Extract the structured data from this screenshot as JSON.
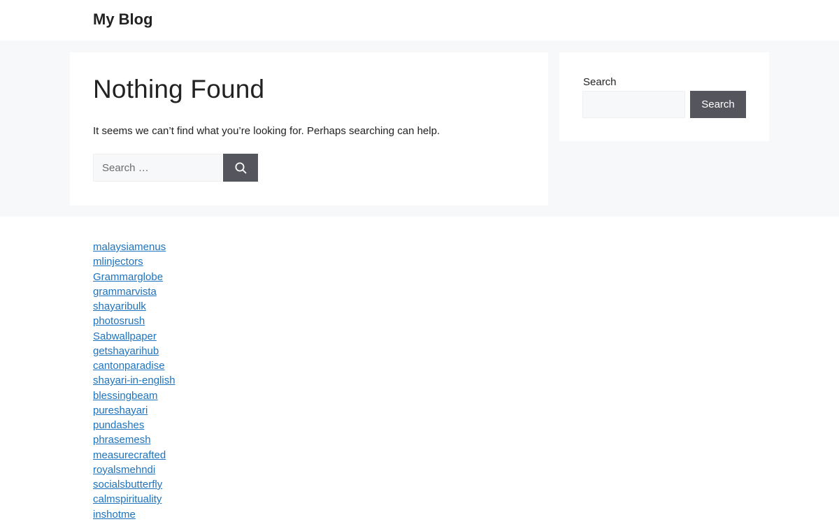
{
  "site": {
    "title": "My Blog"
  },
  "main": {
    "heading": "Nothing Found",
    "message": "It seems we can’t find what you’re looking for. Perhaps searching can help.",
    "search": {
      "placeholder": "Search …",
      "value": "",
      "submit_icon": "search-icon"
    }
  },
  "sidebar": {
    "widget_label": "Search",
    "input_value": "",
    "button_label": "Search"
  },
  "colors": {
    "background_band": "#f7f8f9",
    "button": "#55555e",
    "link": "#1e73be"
  },
  "links": [
    "malaysiamenus",
    "mlinjectors",
    "Grammarglobe",
    "grammarvista",
    "shayaribulk",
    "photosrush",
    "Sabwallpaper",
    "getshayarihub",
    "cantonparadise",
    "shayari-in-english",
    "blessingbeam",
    "pureshayari",
    "pundashes",
    "phrasemesh",
    "measurecrafted",
    "royalsmehndi",
    "socialsbutterfly",
    "calmspirituality",
    "inshotme"
  ]
}
